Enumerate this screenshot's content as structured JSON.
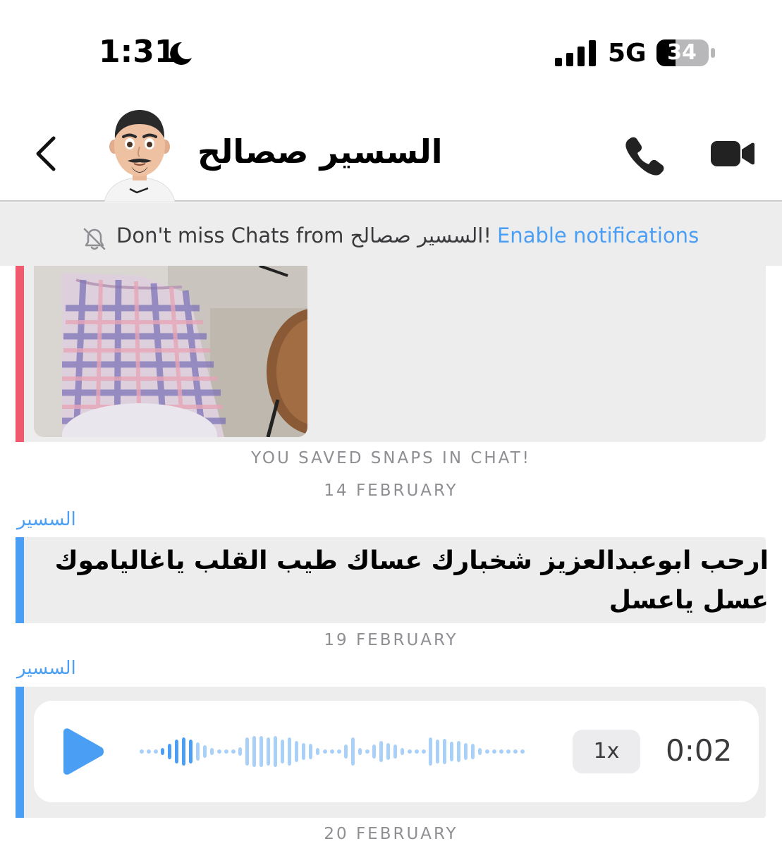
{
  "status_bar": {
    "time": "1:31",
    "network": "5G",
    "battery": "34",
    "icons": [
      "moon-icon",
      "signal-icon",
      "battery-icon"
    ]
  },
  "header": {
    "contact_name": "السسير صصالح",
    "icons": [
      "chevron-left-icon",
      "phone-icon",
      "video-camera-icon"
    ]
  },
  "notification": {
    "text": "Don't miss Chats from السسير صصالح!",
    "link": "Enable notifications",
    "icon": "bell-off-icon"
  },
  "chat": {
    "saved_notice": "YOU SAVED SNAPS IN CHAT!",
    "date_1": "14 FEBRUARY",
    "sender_1": "السسير",
    "message_1": "ارحب ابوعبدالعزيز شخبارك عساك طيب القلب ياغالياموك عسل ياعسل",
    "date_2": "19 FEBRUARY",
    "sender_2": "السسير",
    "voice": {
      "speed": "1x",
      "duration": "0:02",
      "icon": "play-icon"
    },
    "date_3": "20 FEBRUARY"
  },
  "colors": {
    "accent_blue": "#4a9ff5",
    "snap_red": "#ef5a6f",
    "bubble_bg": "#ededee"
  }
}
